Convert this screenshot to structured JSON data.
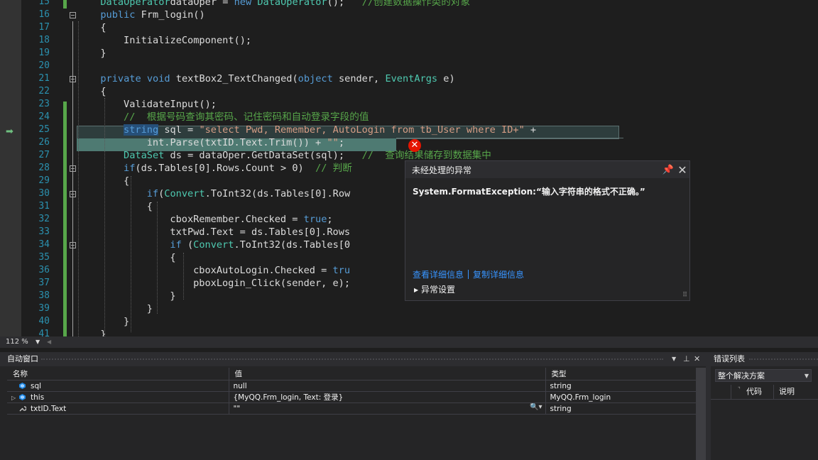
{
  "colors": {
    "keyword": "#569cd6",
    "type": "#4ec9b0",
    "string": "#d69d85",
    "comment": "#57a64a",
    "line_number": "#2b91af",
    "link": "#3794ff",
    "error": "#e51400"
  },
  "editor": {
    "lines": [
      {
        "n": "15",
        "segs": [
          [
            "ty",
            "DataOperator"
          ],
          [
            "",
            "dataOper = "
          ],
          [
            "kw",
            "new"
          ],
          [
            "",
            ""
          ],
          [
            "ty",
            "DataOperator"
          ],
          [
            "",
            "();   "
          ],
          [
            "cm",
            "//创建数据操作类的对象"
          ]
        ],
        "indent": 2
      },
      {
        "n": "16",
        "segs": [
          [
            "kw",
            "public"
          ],
          [
            "",
            " Frm_login()"
          ]
        ],
        "indent": 2
      },
      {
        "n": "17",
        "segs": [
          [
            "",
            "{"
          ]
        ],
        "indent": 2
      },
      {
        "n": "18",
        "segs": [
          [
            "",
            "InitializeComponent();"
          ]
        ],
        "indent": 3
      },
      {
        "n": "19",
        "segs": [
          [
            "",
            "}"
          ]
        ],
        "indent": 2
      },
      {
        "n": "20",
        "segs": [],
        "indent": 2
      },
      {
        "n": "21",
        "segs": [
          [
            "kw",
            "private"
          ],
          [
            "",
            " "
          ],
          [
            "kw",
            "void"
          ],
          [
            "",
            " textBox2_TextChanged("
          ],
          [
            "kw",
            "object"
          ],
          [
            "",
            " sender, "
          ],
          [
            "ty",
            "EventArgs"
          ],
          [
            "",
            " e)"
          ]
        ],
        "indent": 2
      },
      {
        "n": "22",
        "segs": [
          [
            "",
            "{"
          ]
        ],
        "indent": 2
      },
      {
        "n": "23",
        "segs": [
          [
            "",
            "ValidateInput();"
          ]
        ],
        "indent": 3
      },
      {
        "n": "24",
        "segs": [
          [
            "cm",
            "//  根据号码查询其密码、记住密码和自动登录字段的值"
          ]
        ],
        "indent": 3
      },
      {
        "n": "25",
        "segs": [
          [
            "kwsel",
            "string"
          ],
          [
            "",
            " sql = "
          ],
          [
            "st",
            "\"select Pwd, Remember, AutoLogin from tb_User where ID+\""
          ],
          [
            "",
            " +"
          ]
        ],
        "indent": 3
      },
      {
        "n": "26",
        "segs": [
          [
            "",
            "int.Parse(txtID.Text.Trim()) + "
          ],
          [
            "st",
            "\"\""
          ],
          [
            "",
            ";"
          ]
        ],
        "indent": 4
      },
      {
        "n": "27",
        "segs": [
          [
            "ty",
            "DataSet"
          ],
          [
            "",
            " ds = dataOper.GetDataSet(sql);   "
          ],
          [
            "cm",
            "//  查询结果储存到数据集中"
          ]
        ],
        "indent": 3
      },
      {
        "n": "28",
        "segs": [
          [
            "kw",
            "if"
          ],
          [
            "",
            "(ds.Tables[0].Rows.Count > 0)  "
          ],
          [
            "cm",
            "// 判断"
          ]
        ],
        "indent": 3
      },
      {
        "n": "29",
        "segs": [
          [
            "",
            "{"
          ]
        ],
        "indent": 3
      },
      {
        "n": "30",
        "segs": [
          [
            "kw",
            "if"
          ],
          [
            "",
            "("
          ],
          [
            "ty",
            "Convert"
          ],
          [
            "",
            ".ToInt32(ds.Tables[0].Row"
          ]
        ],
        "indent": 4
      },
      {
        "n": "31",
        "segs": [
          [
            "",
            "{"
          ]
        ],
        "indent": 4
      },
      {
        "n": "32",
        "segs": [
          [
            "",
            "cboxRemember.Checked = "
          ],
          [
            "kw",
            "true"
          ],
          [
            "",
            ";"
          ]
        ],
        "indent": 5
      },
      {
        "n": "33",
        "segs": [
          [
            "",
            "txtPwd.Text = ds.Tables[0].Rows"
          ]
        ],
        "indent": 5
      },
      {
        "n": "34",
        "segs": [
          [
            "kw",
            "if"
          ],
          [
            "",
            " ("
          ],
          [
            "ty",
            "Convert"
          ],
          [
            "",
            ".ToInt32(ds.Tables[0"
          ]
        ],
        "indent": 5
      },
      {
        "n": "35",
        "segs": [
          [
            "",
            "{"
          ]
        ],
        "indent": 5
      },
      {
        "n": "36",
        "segs": [
          [
            "",
            "cboxAutoLogin.Checked = "
          ],
          [
            "kw",
            "tru"
          ]
        ],
        "indent": 6
      },
      {
        "n": "37",
        "segs": [
          [
            "",
            "pboxLogin_Click(sender, e);"
          ]
        ],
        "indent": 6
      },
      {
        "n": "38",
        "segs": [
          [
            "",
            "}"
          ]
        ],
        "indent": 5
      },
      {
        "n": "39",
        "segs": [
          [
            "",
            "}"
          ]
        ],
        "indent": 4
      },
      {
        "n": "40",
        "segs": [
          [
            "",
            "}"
          ]
        ],
        "indent": 3
      },
      {
        "n": "41",
        "segs": [
          [
            "",
            "}"
          ]
        ],
        "indent": 2
      }
    ]
  },
  "exception_popup": {
    "title": "未经处理的异常",
    "message": "System.FormatException:“输入字符串的格式不正确。”",
    "view_details": "查看详细信息",
    "copy_details": "复制详细信息",
    "settings": "异常设置"
  },
  "zoom": {
    "level": "112 %"
  },
  "autos": {
    "title": "自动窗口",
    "columns": {
      "name": "名称",
      "value": "值",
      "type": "类型"
    },
    "rows": [
      {
        "name": "sql",
        "value": "null",
        "type": "string",
        "expandable": false
      },
      {
        "name": "this",
        "value": "{MyQQ.Frm_login, Text: 登录}",
        "type": "MyQQ.Frm_login",
        "expandable": true
      },
      {
        "name": "txtID.Text",
        "value": "\"\"",
        "type": "string",
        "expandable": false
      }
    ]
  },
  "error_list": {
    "title": "错误列表",
    "scope": "整个解决方案",
    "columns": {
      "code": "代码",
      "desc": "说明"
    }
  }
}
